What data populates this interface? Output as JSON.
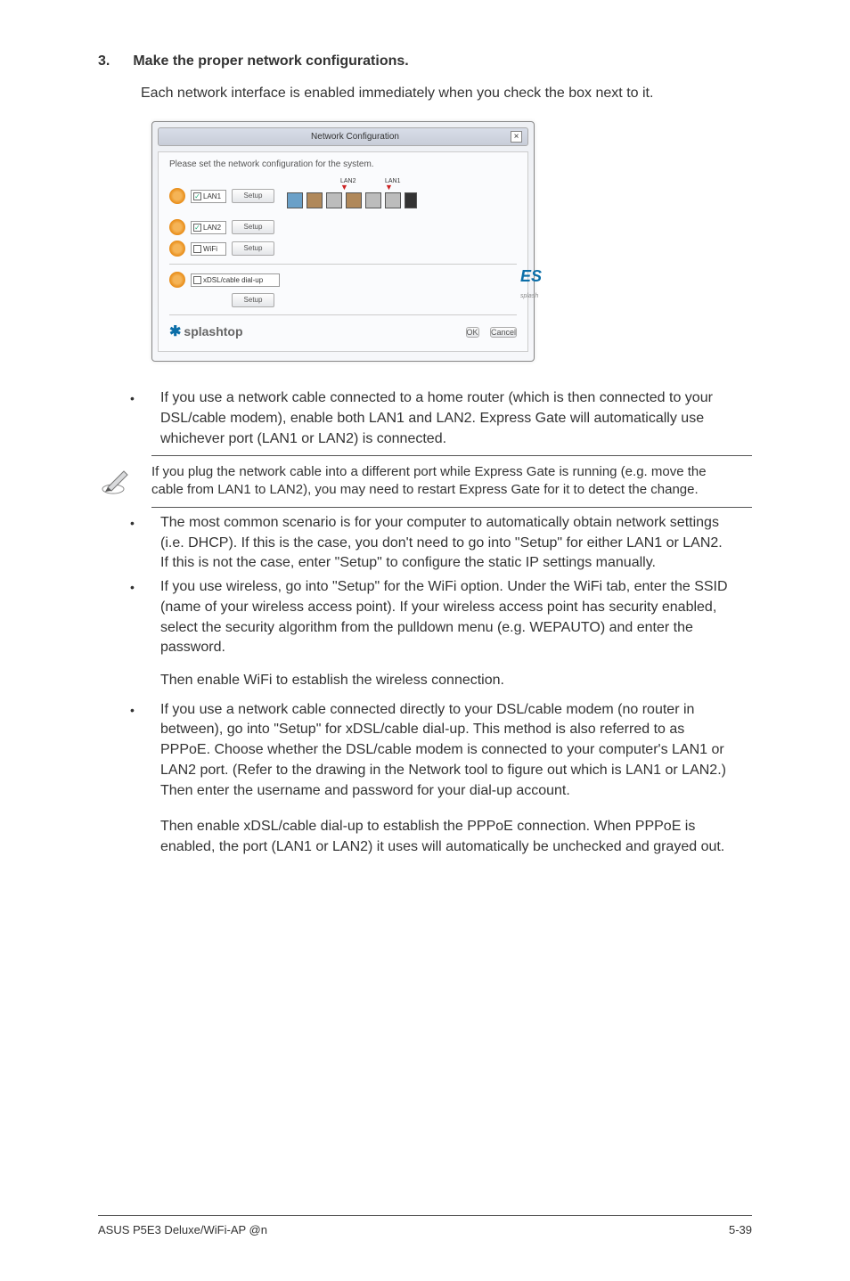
{
  "step": {
    "num": "3.",
    "title": "Make the proper network configurations.",
    "desc": "Each network interface is enabled immediately when you check the box next to it."
  },
  "dialog": {
    "title": "Network Configuration",
    "close": "×",
    "instruction": "Please set the network configuration for the system.",
    "rows": {
      "lan1": {
        "check": "✓",
        "label": "LAN1",
        "btn": "Setup"
      },
      "lan2": {
        "check": "✓",
        "label": "LAN2",
        "btn": "Setup"
      },
      "wifi": {
        "check": "",
        "label": "WiFi",
        "btn": "Setup"
      },
      "xdsl": {
        "check": "",
        "label": "xDSL/cable dial-up",
        "btn": "Setup"
      }
    },
    "ports": {
      "lan2": "LAN2",
      "lan1": "LAN1"
    },
    "side_text": "ES",
    "side_sub": "splash",
    "brand": "splashtop",
    "ok": "OK",
    "cancel": "Cancel"
  },
  "bullets": {
    "b1": "If you use a network cable connected to a home router (which is then connected to your DSL/cable modem), enable both LAN1 and LAN2. Express Gate will automatically use whichever port (LAN1 or LAN2) is connected.",
    "note": "If you plug the network cable into a different port while Express Gate is running (e.g. move the cable from LAN1 to LAN2), you may need to restart Express Gate for it to detect the change.",
    "b2": "The most common scenario is for your computer to automatically obtain network settings (i.e. DHCP). If this is the case, you don't need to go into \"Setup\" for either LAN1 or LAN2. If this is not the case, enter \"Setup\" to configure the static IP settings manually.",
    "b3": "If you use wireless, go into \"Setup\" for the WiFi option. Under the WiFi tab, enter the SSID (name of your wireless access point). If your wireless access point has security enabled, select the security algorithm from the pulldown menu (e.g. WEPAUTO) and enter the password.",
    "b3_sub": "Then enable WiFi to establish the wireless connection.",
    "b4": "If you use a network cable connected directly to your DSL/cable modem (no router in between), go into \"Setup\" for xDSL/cable dial-up. This method is also referred to as PPPoE. Choose whether the DSL/cable modem is connected to your computer's LAN1 or LAN2 port. (Refer to the drawing in the Network tool to figure out which is LAN1 or LAN2.) Then enter the username and password for your dial-up account.",
    "b4_sub": "Then enable xDSL/cable dial-up to establish the PPPoE connection. When PPPoE is enabled, the port (LAN1 or LAN2) it uses will automatically be unchecked and grayed out."
  },
  "footer": {
    "left": "ASUS P5E3 Deluxe/WiFi-AP @n",
    "right": "5-39"
  }
}
